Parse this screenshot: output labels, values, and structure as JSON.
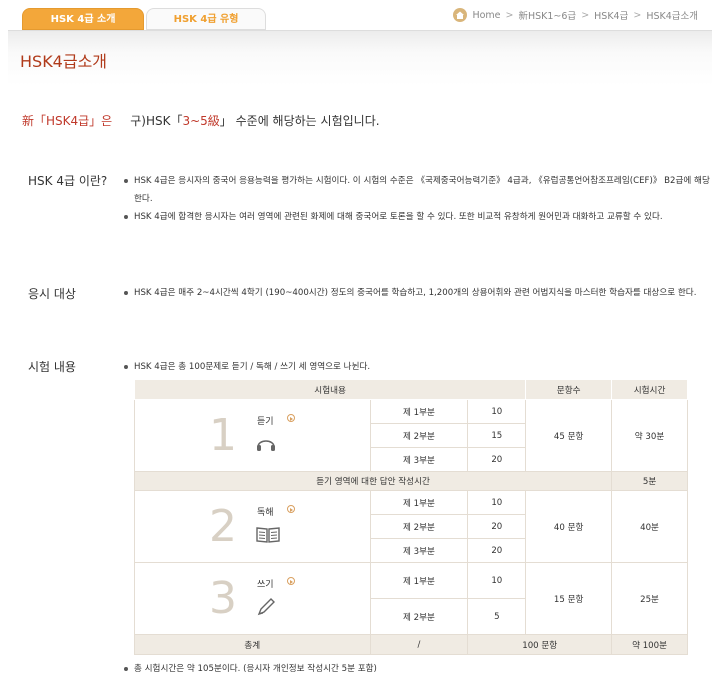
{
  "tabs": [
    {
      "label": "HSK 4급 소개",
      "active": true
    },
    {
      "label": "HSK 4급 유형",
      "active": false
    }
  ],
  "breadcrumb": [
    "Home",
    "新HSK1~6급",
    "HSK4급",
    "HSK4급소개"
  ],
  "breadcrumb_sep": ">",
  "page_title": "HSK4급소개",
  "intro": {
    "new": "新「HSK4급」은",
    "old": "구)HSK「",
    "levels": "3~5級",
    "close": "」",
    "rest": " 수준에 해당하는 시험입니다."
  },
  "sections": {
    "about": {
      "label": "HSK 4급 이란?",
      "bullets": [
        "HSK 4급은 응시자의 중국어 응용능력을 평가하는 시험이다. 이 시험의 수준은 《국제중국어능력기준》 4급과, 《유럽공통언어참조프레임(CEF)》 B2급에 해당한다.",
        "HSK 4급에 합격한 응시자는 여러 영역에 관련된 화제에 대해 중국어로 토론을 할 수 있다. 또한 비교적 유창하게 원어민과 대화하고 교류할 수 있다."
      ]
    },
    "target": {
      "label": "응시 대상",
      "bullets": [
        "HSK 4급은 매주 2~4시간씩 4학기 (190~400시간) 정도의 중국어를 학습하고, 1,200개의 상용어휘와 관련 어법지식을 마스터한 학습자를 대상으로 한다."
      ]
    },
    "content": {
      "label": "시험 내용",
      "bullet": "HSK 4급은 총 100문제로 듣기 / 독해 / 쓰기 세 영역으로 나뉜다."
    }
  },
  "table": {
    "headers": [
      "시험내용",
      "문항수",
      "시험시간"
    ],
    "listening": {
      "num": "1",
      "name": "듣기",
      "icon": "headphones-icon",
      "parts": [
        {
          "part": "제 1부분",
          "count": "10"
        },
        {
          "part": "제 2부분",
          "count": "15"
        },
        {
          "part": "제 3부분",
          "count": "20"
        }
      ],
      "total": "45 문항",
      "time": "약 30분"
    },
    "answer_sheet": {
      "label": "듣기 영역에 대한 답안 작성시간",
      "time": "5분"
    },
    "reading": {
      "num": "2",
      "name": "독해",
      "icon": "book-icon",
      "parts": [
        {
          "part": "제 1부분",
          "count": "10"
        },
        {
          "part": "제 2부분",
          "count": "20"
        },
        {
          "part": "제 3부분",
          "count": "20"
        }
      ],
      "total": "40 문항",
      "time": "40분"
    },
    "writing": {
      "num": "3",
      "name": "쓰기",
      "icon": "pen-icon",
      "parts": [
        {
          "part": "제 1부분",
          "count": "10"
        },
        {
          "part": "제 2부분",
          "count": "5"
        }
      ],
      "total": "15 문항",
      "time": "25분"
    },
    "total_row": {
      "label": "총계",
      "slash": "/",
      "count": "100 문항",
      "time": "약 100분"
    }
  },
  "footnote": "총 시험시간은 약 105분이다. (응시자 개인정보 작성시간 5분 포함)",
  "colors": {
    "accent": "#f3a73a",
    "title": "#b03a1a",
    "highlight": "#c0392b",
    "table_band": "#f0ebe3"
  }
}
